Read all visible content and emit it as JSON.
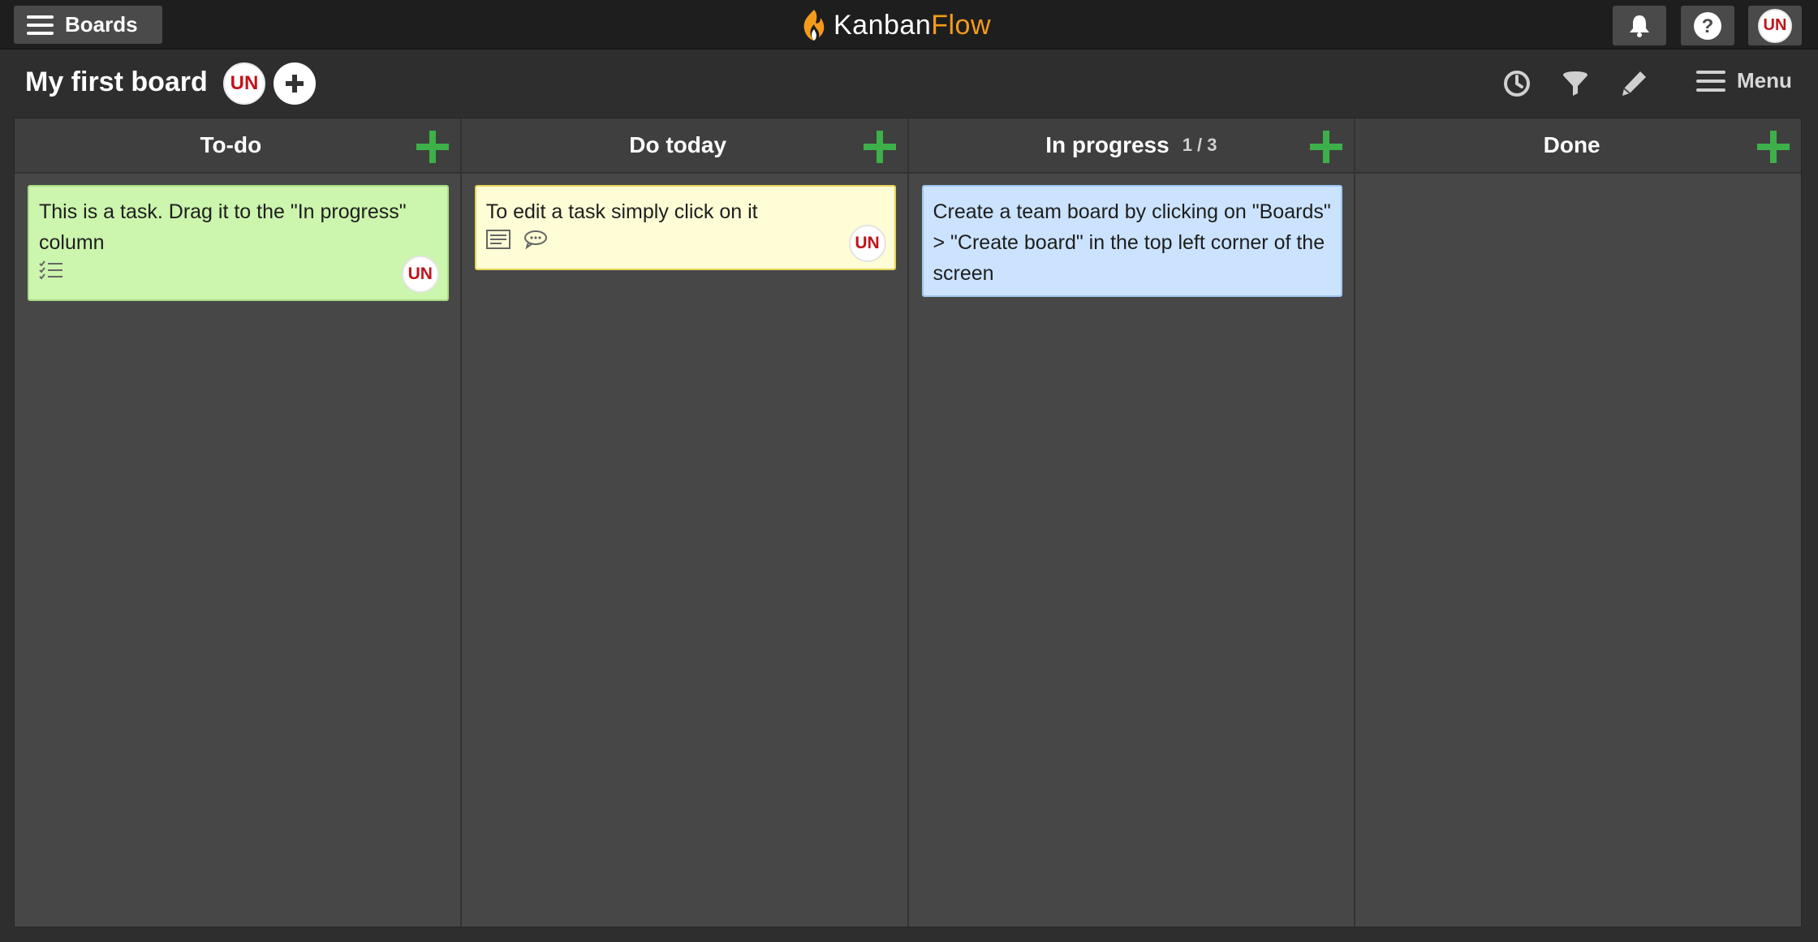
{
  "app": {
    "logo_part1": "Kanban",
    "logo_part2": "Flow",
    "boards_button": "Boards",
    "user_initials": "UN"
  },
  "board": {
    "title": "My first board",
    "member_initials": "UN",
    "menu_label": "Menu"
  },
  "columns": [
    {
      "name": "To-do",
      "wip": "",
      "cards": [
        {
          "text": "This is a task. Drag it to the \"In progress\" column",
          "color": "green",
          "icons": [
            "checklist-icon"
          ],
          "assignee": "UN"
        }
      ]
    },
    {
      "name": "Do today",
      "wip": "",
      "cards": [
        {
          "text": "To edit a task simply click on it",
          "color": "yellow",
          "icons": [
            "description-icon",
            "comment-icon"
          ],
          "assignee": "UN"
        }
      ]
    },
    {
      "name": "In progress",
      "wip": "1 / 3",
      "cards": [
        {
          "text": "Create a team board by clicking on \"Boards\" > \"Create board\" in the top left corner of the screen",
          "color": "blue",
          "icons": [],
          "assignee": ""
        }
      ]
    },
    {
      "name": "Done",
      "wip": "",
      "cards": []
    }
  ],
  "colors": {
    "topbar": "#1e1e1e",
    "column_bg": "#474747",
    "add_green": "#3db049",
    "logo_orange": "#f59b1c",
    "avatar_red": "#c0141b",
    "card_green": "#ccf5ad",
    "card_yellow": "#fffdd6",
    "card_blue": "#cbe3ff"
  }
}
